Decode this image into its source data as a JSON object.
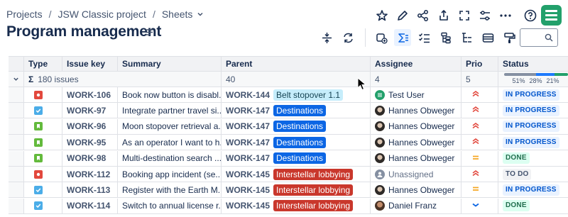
{
  "breadcrumb": {
    "items": [
      "Projects",
      "JSW Classic project",
      "Sheets"
    ],
    "separator": "/"
  },
  "page": {
    "title": "Program management"
  },
  "header_actions": [
    "star-icon",
    "edit-icon",
    "share-icon",
    "export-icon",
    "fullscreen-icon",
    "settings-sliders-icon",
    "more-icon",
    "help-icon",
    "sheets-app-logo"
  ],
  "toolbar_actions": [
    "row-height-icon",
    "refresh-icon",
    "add-issue-icon",
    "sum-icon",
    "checklist-icon",
    "hierarchy-icon",
    "tree-icon",
    "card-icon",
    "paint-format-icon"
  ],
  "search": {
    "placeholder": ""
  },
  "columns": [
    "Type",
    "Issue key",
    "Summary",
    "Parent",
    "Assignee",
    "Prio",
    "Status"
  ],
  "summary_row": {
    "sigma": "Σ",
    "issues": "180 issues",
    "parent": "40",
    "assignee": "4",
    "prio": "5",
    "status_dist": [
      {
        "label": "51%",
        "value": 51,
        "color": "#8590a2"
      },
      {
        "label": "28%",
        "value": 28,
        "color": "#1d7afc"
      },
      {
        "label": "21%",
        "value": 21,
        "color": "#22a06b"
      }
    ]
  },
  "rows": [
    {
      "type": "bug",
      "key": "WORK-106",
      "summary": "Book now button is disabl...",
      "parent_key": "WORK-144",
      "parent_label": "Belt stopover 1.1",
      "parent_style": "light-blue",
      "assignee": "Test User",
      "assignee_avatar": "green",
      "prio": "high",
      "status": "IN PROGRESS",
      "status_kind": "inprogress"
    },
    {
      "type": "task",
      "key": "WORK-97",
      "summary": "Integrate partner travel si...",
      "parent_key": "WORK-147",
      "parent_label": "Destinations",
      "parent_style": "blue",
      "assignee": "Hannes Obweger",
      "assignee_avatar": "photo",
      "prio": "high",
      "status": "IN PROGRESS",
      "status_kind": "inprogress"
    },
    {
      "type": "story",
      "key": "WORK-96",
      "summary": "Moon stopover retrieval a...",
      "parent_key": "WORK-147",
      "parent_label": "Destinations",
      "parent_style": "blue",
      "assignee": "Hannes Obweger",
      "assignee_avatar": "photo",
      "prio": "high",
      "status": "IN PROGRESS",
      "status_kind": "inprogress"
    },
    {
      "type": "story",
      "key": "WORK-95",
      "summary": "As an operator I want to h...",
      "parent_key": "WORK-147",
      "parent_label": "Destinations",
      "parent_style": "blue",
      "assignee": "Hannes Obweger",
      "assignee_avatar": "photo",
      "prio": "high",
      "status": "IN PROGRESS",
      "status_kind": "inprogress"
    },
    {
      "type": "story",
      "key": "WORK-98",
      "summary": "Multi-destination search ...",
      "parent_key": "WORK-147",
      "parent_label": "Destinations",
      "parent_style": "blue",
      "assignee": "Hannes Obweger",
      "assignee_avatar": "photo",
      "prio": "medium",
      "status": "DONE",
      "status_kind": "done"
    },
    {
      "type": "bug",
      "key": "WORK-112",
      "summary": "Booking app incident (se...",
      "parent_key": "WORK-145",
      "parent_label": "Interstellar lobbying",
      "parent_style": "red",
      "assignee": "Unassigned",
      "assignee_avatar": "none",
      "prio": "high",
      "status": "TO DO",
      "status_kind": "todo"
    },
    {
      "type": "task",
      "key": "WORK-113",
      "summary": "Register with the Earth M...",
      "parent_key": "WORK-145",
      "parent_label": "Interstellar lobbying",
      "parent_style": "red",
      "assignee": "Hannes Obweger",
      "assignee_avatar": "photo",
      "prio": "medium",
      "status": "IN PROGRESS",
      "status_kind": "inprogress"
    },
    {
      "type": "task",
      "key": "WORK-114",
      "summary": "Switch to annual license r...",
      "parent_key": "WORK-145",
      "parent_label": "Interstellar lobbying",
      "parent_style": "red",
      "assignee": "Daniel Franz",
      "assignee_avatar": "photo2",
      "prio": "low",
      "status": "DONE",
      "status_kind": "done"
    }
  ],
  "colors": {
    "bug": "#e2483d",
    "task": "#4bade8",
    "story": "#63ba3c",
    "light_blue_bg": "#c6edfb",
    "light_blue_fg": "#164555",
    "blue_bg": "#0c66e4",
    "red_bg": "#c9372c",
    "prio_high": "#e2483d",
    "prio_medium": "#f5a623",
    "prio_low": "#0c66e4"
  }
}
